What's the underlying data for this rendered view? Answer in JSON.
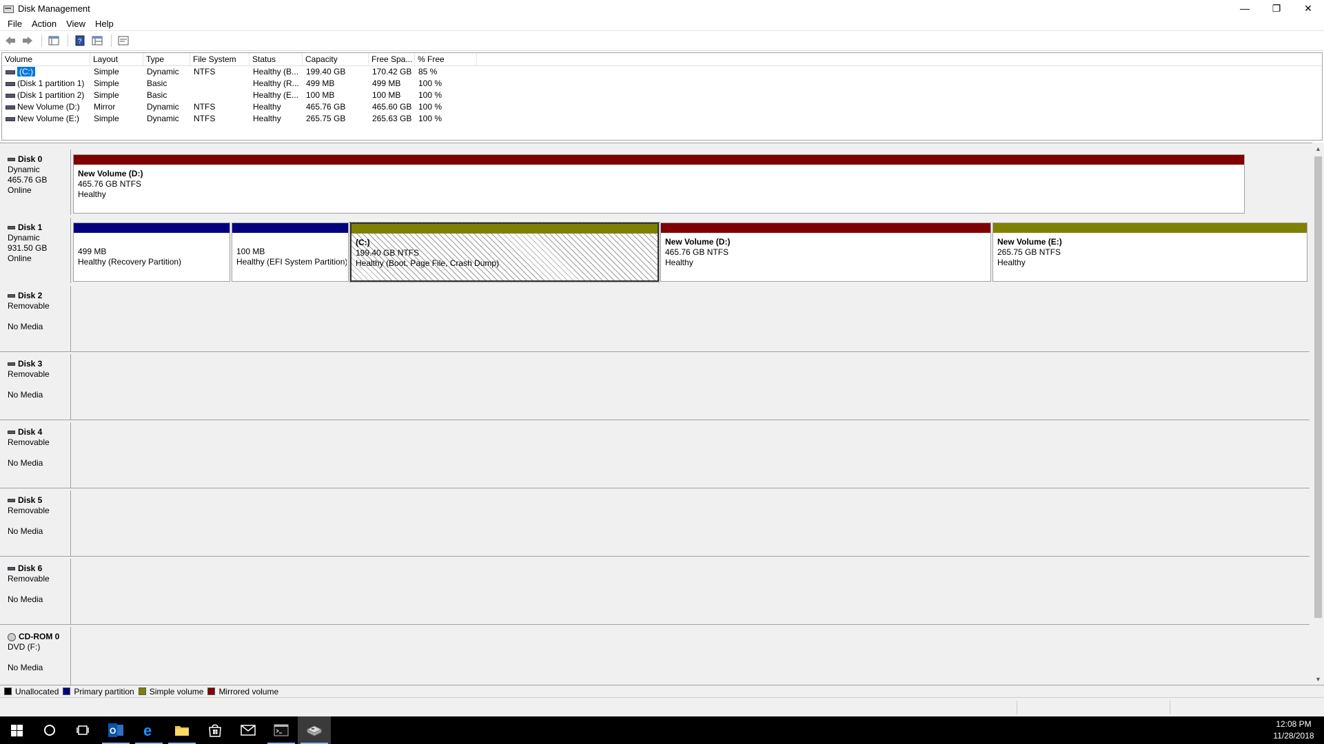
{
  "window": {
    "title": "Disk Management",
    "minimize": "—",
    "restore": "❐",
    "close": "✕"
  },
  "menu": [
    "File",
    "Action",
    "View",
    "Help"
  ],
  "volume_list": {
    "columns": [
      "Volume",
      "Layout",
      "Type",
      "File System",
      "Status",
      "Capacity",
      "Free Spa...",
      "% Free"
    ],
    "rows": [
      {
        "volume": "(C:)",
        "layout": "Simple",
        "type": "Dynamic",
        "fs": "NTFS",
        "status": "Healthy (B...",
        "capacity": "199.40 GB",
        "free": "170.42 GB",
        "pct": "85 %",
        "selected": true
      },
      {
        "volume": "(Disk 1 partition 1)",
        "layout": "Simple",
        "type": "Basic",
        "fs": "",
        "status": "Healthy (R...",
        "capacity": "499 MB",
        "free": "499 MB",
        "pct": "100 %"
      },
      {
        "volume": "(Disk 1 partition 2)",
        "layout": "Simple",
        "type": "Basic",
        "fs": "",
        "status": "Healthy (E...",
        "capacity": "100 MB",
        "free": "100 MB",
        "pct": "100 %"
      },
      {
        "volume": "New Volume (D:)",
        "layout": "Mirror",
        "type": "Dynamic",
        "fs": "NTFS",
        "status": "Healthy",
        "capacity": "465.76 GB",
        "free": "465.60 GB",
        "pct": "100 %"
      },
      {
        "volume": "New Volume (E:)",
        "layout": "Simple",
        "type": "Dynamic",
        "fs": "NTFS",
        "status": "Healthy",
        "capacity": "265.75 GB",
        "free": "265.63 GB",
        "pct": "100 %"
      }
    ]
  },
  "disks": {
    "disk0": {
      "name": "Disk 0",
      "type": "Dynamic",
      "size": "465.76 GB",
      "state": "Online",
      "p1": {
        "title": "New Volume  (D:)",
        "size": "465.76 GB NTFS",
        "status": "Healthy"
      }
    },
    "disk1": {
      "name": "Disk 1",
      "type": "Dynamic",
      "size": "931.50 GB",
      "state": "Online",
      "p1": {
        "size": "499 MB",
        "status": "Healthy (Recovery Partition)"
      },
      "p2": {
        "size": "100 MB",
        "status": "Healthy (EFI System Partition)"
      },
      "p3": {
        "title": "(C:)",
        "size": "199.40 GB NTFS",
        "status": "Healthy (Boot, Page File, Crash Dump)"
      },
      "p4": {
        "title": "New Volume  (D:)",
        "size": "465.76 GB NTFS",
        "status": "Healthy"
      },
      "p5": {
        "title": "New Volume  (E:)",
        "size": "265.75 GB NTFS",
        "status": "Healthy"
      }
    },
    "disk2": {
      "name": "Disk 2",
      "type": "Removable",
      "state": "No Media"
    },
    "disk3": {
      "name": "Disk 3",
      "type": "Removable",
      "state": "No Media"
    },
    "disk4": {
      "name": "Disk 4",
      "type": "Removable",
      "state": "No Media"
    },
    "disk5": {
      "name": "Disk 5",
      "type": "Removable",
      "state": "No Media"
    },
    "disk6": {
      "name": "Disk 6",
      "type": "Removable",
      "state": "No Media"
    },
    "cdrom0": {
      "name": "CD-ROM 0",
      "type": "DVD (F:)",
      "state": "No Media"
    }
  },
  "legend": {
    "unallocated": "Unallocated",
    "primary": "Primary partition",
    "simple": "Simple volume",
    "mirrored": "Mirrored volume"
  },
  "colors": {
    "unallocated": "#000000",
    "primary": "#00007f",
    "simple": "#808000",
    "mirrored": "#7f0000",
    "selection": "#0078d7"
  },
  "taskbar": {
    "icons": [
      "windows-start-icon",
      "cortana-search-icon",
      "task-view-icon",
      "outlook-icon",
      "edge-icon",
      "file-explorer-icon",
      "store-icon",
      "mail-icon",
      "command-prompt-icon",
      "disk-management-icon"
    ],
    "time": "12:08 PM",
    "date": "11/28/2018"
  }
}
